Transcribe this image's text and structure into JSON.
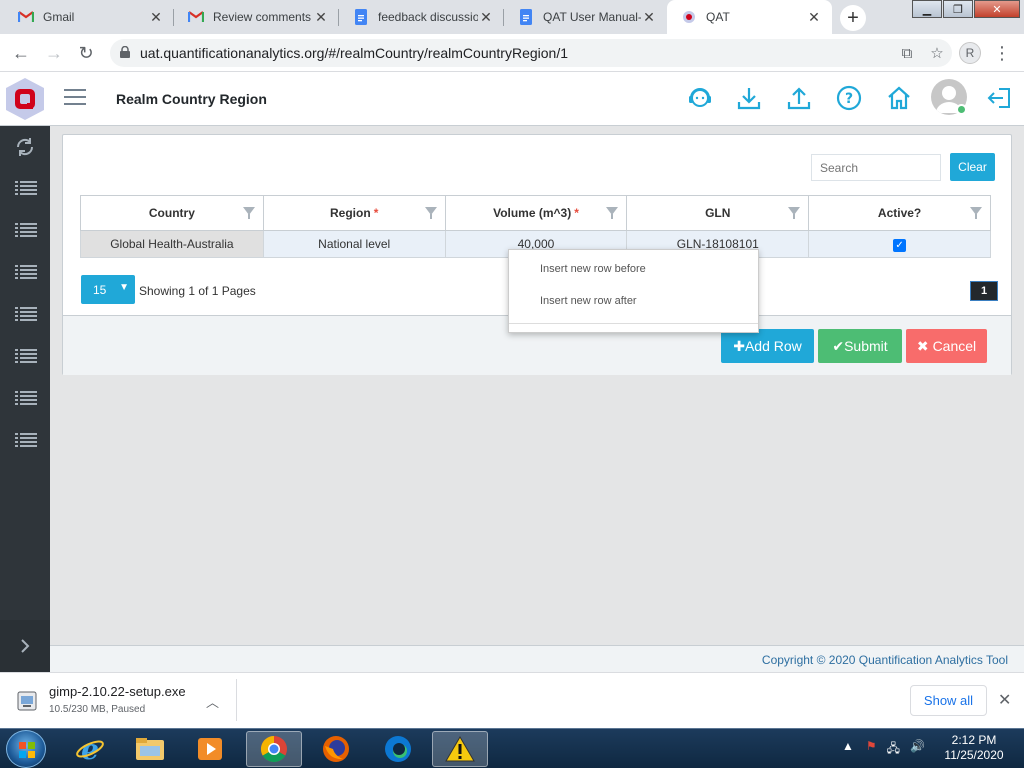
{
  "browser": {
    "tabs": [
      {
        "title": "Gmail",
        "icon": "gmail-icon"
      },
      {
        "title": "Review comments",
        "icon": "gmail-icon"
      },
      {
        "title": "feedback discussio",
        "icon": "google-docs-icon"
      },
      {
        "title": "QAT User Manual-",
        "icon": "google-docs-icon"
      },
      {
        "title": "QAT",
        "icon": "qat-favicon",
        "active": true
      }
    ],
    "url": "uat.quantificationanalytics.org/#/realmCountry/realmCountryRegion/1",
    "profile_initial": "R"
  },
  "app": {
    "page_title": "Realm Country Region",
    "brand_color": "#d0021b"
  },
  "toolbar": {
    "search_placeholder": "Search",
    "clear_label": "Clear"
  },
  "table": {
    "columns": [
      {
        "label": "Country",
        "required": false
      },
      {
        "label": "Region",
        "required": true
      },
      {
        "label": "Volume (m^3)",
        "required": true
      },
      {
        "label": "GLN",
        "required": false
      },
      {
        "label": "Active?",
        "required": false
      }
    ],
    "required_mark": "*",
    "rows": [
      {
        "country": "Global Health-Australia",
        "region": "National level",
        "volume": "40,000",
        "gln": "GLN-18108101",
        "active": true
      }
    ]
  },
  "pagination": {
    "page_size": "15",
    "showing_text": "Showing 1 of 1 Pages",
    "current_page": "1"
  },
  "context_menu": {
    "items": [
      "Insert new row before",
      "Insert new row after"
    ]
  },
  "actions": {
    "add_row": "Add Row",
    "submit": "Submit",
    "cancel": "Cancel"
  },
  "footer": {
    "copyright": "Copyright © 2020 Quantification Analytics Tool"
  },
  "download": {
    "filename": "gimp-2.10.22-setup.exe",
    "status": "10.5/230 MB, Paused",
    "show_all": "Show all"
  },
  "taskbar": {
    "time": "2:12 PM",
    "date": "11/25/2020"
  },
  "colors": {
    "primary": "#20a8d8",
    "success": "#4dbd74",
    "danger": "#f86c6b",
    "sidebar": "#2f353a"
  }
}
